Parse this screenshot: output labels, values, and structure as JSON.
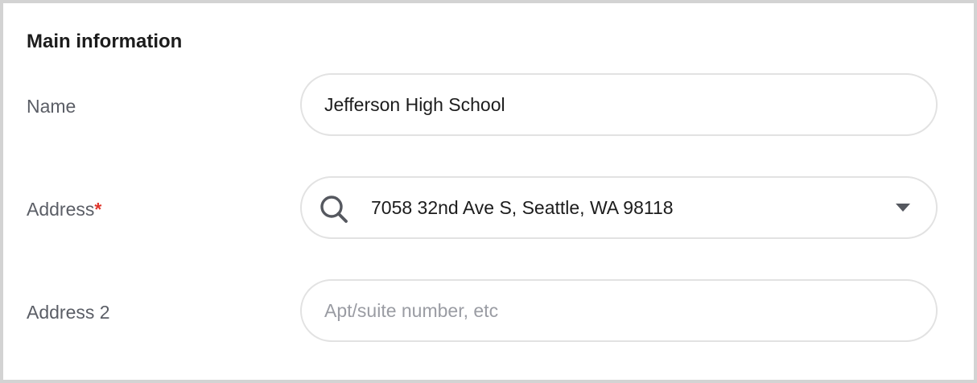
{
  "section": {
    "title": "Main information"
  },
  "name_row": {
    "label": "Name",
    "value": "Jefferson High School"
  },
  "address_row": {
    "label": "Address",
    "required_mark": "*",
    "value": "7058 32nd Ave S, Seattle, WA 98118",
    "leading_icon": "search-icon",
    "trailing_icon": "dropdown-caret-icon"
  },
  "address2_row": {
    "label": "Address 2",
    "placeholder": "Apt/suite number, etc"
  },
  "colors": {
    "required": "#e0362c",
    "label": "#5b5e66",
    "text": "#1c1c1c",
    "placeholder": "#9a9ca3",
    "field_border": "#e2e2e2"
  }
}
